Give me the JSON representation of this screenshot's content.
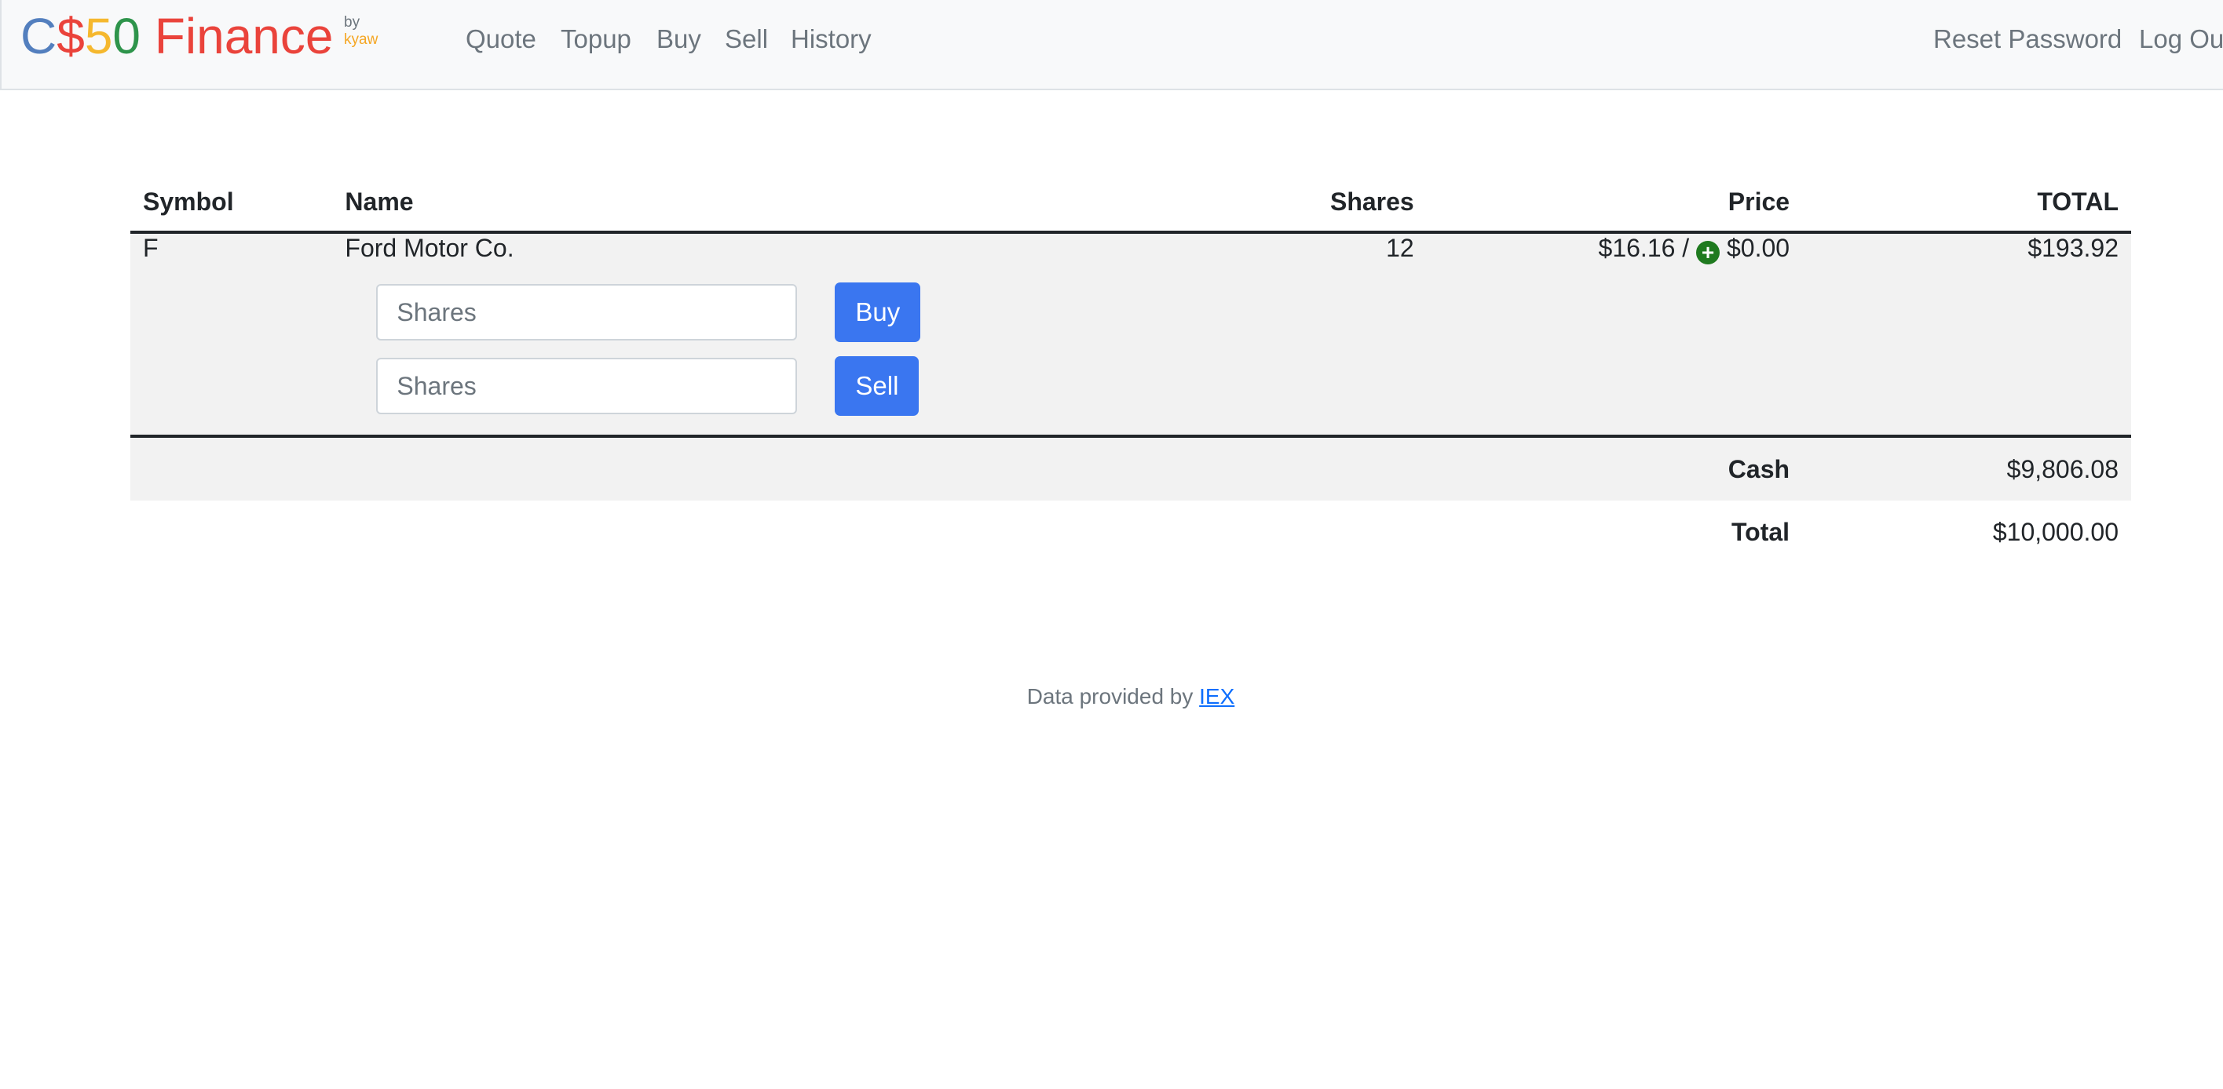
{
  "brand": {
    "letters": [
      "C",
      "$",
      "5",
      "0"
    ],
    "suffix": "Finance",
    "by": "by",
    "author": "kyaw"
  },
  "nav": {
    "left": [
      "Quote",
      "Topup",
      "Buy",
      "Sell",
      "History"
    ],
    "right": [
      "Reset Password",
      "Log Out"
    ]
  },
  "table": {
    "headers": [
      "Symbol",
      "Name",
      "Shares",
      "Price",
      "TOTAL"
    ],
    "rows": [
      {
        "symbol": "F",
        "name": "Ford Motor Co.",
        "shares": "12",
        "price": "$16.16",
        "price_separator": "/",
        "change": "$0.00",
        "total": "$193.92",
        "buy_placeholder": "Shares",
        "buy_label": "Buy",
        "sell_placeholder": "Shares",
        "sell_label": "Sell"
      }
    ],
    "cash_label": "Cash",
    "cash_value": "$9,806.08",
    "total_label": "Total",
    "total_value": "$10,000.00"
  },
  "footer": {
    "text": "Data provided by",
    "link": "IEX"
  },
  "colors": {
    "brand_blue": "#537fbe",
    "brand_red": "#ea433b",
    "brand_yellow": "#f5b82e",
    "brand_green": "#2e944b",
    "primary": "#3a76f0",
    "change_positive": "#1f7a1f"
  },
  "icons": {
    "change_indicator": "plus-circle-icon"
  }
}
